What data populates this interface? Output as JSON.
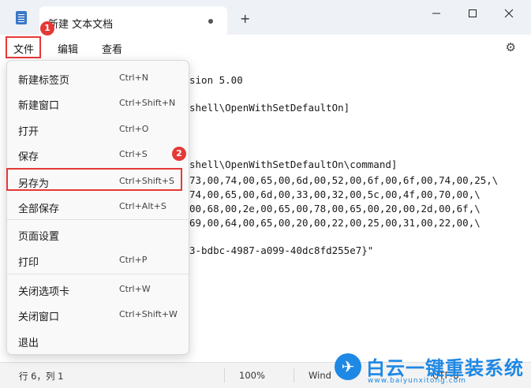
{
  "window": {
    "tab_title": "新建 文本文档",
    "new_tab_icon": "+",
    "minimize_icon": "minimize-icon",
    "maximize_icon": "maximize-icon",
    "close_icon": "close-icon"
  },
  "menubar": {
    "items": [
      "文件",
      "编辑",
      "查看"
    ],
    "settings_icon": "gear-icon"
  },
  "editor": {
    "lines": [
      "sion 5.00",
      "shell\\OpenWithSetDefaultOn]",
      "shell\\OpenWithSetDefaultOn\\command]",
      "73,00,74,00,65,00,6d,00,52,00,6f,00,6f,00,74,00,25,\\",
      "74,00,65,00,6d,00,33,00,32,00,5c,00,4f,00,70,00,\\",
      "00,68,00,2e,00,65,00,78,00,65,00,20,00,2d,00,6f,\\",
      "69,00,64,00,65,00,20,00,22,00,25,00,31,00,22,00,\\",
      "3-bdbc-4987-a099-40dc8fd255e7}\""
    ]
  },
  "file_menu": {
    "items": [
      {
        "label": "新建标签页",
        "shortcut": "Ctrl+N"
      },
      {
        "label": "新建窗口",
        "shortcut": "Ctrl+Shift+N"
      },
      {
        "label": "打开",
        "shortcut": "Ctrl+O"
      },
      {
        "label": "保存",
        "shortcut": "Ctrl+S"
      },
      {
        "label": "另存为",
        "shortcut": "Ctrl+Shift+S"
      },
      {
        "label": "全部保存",
        "shortcut": "Ctrl+Alt+S"
      },
      {
        "label": "页面设置",
        "shortcut": ""
      },
      {
        "label": "打印",
        "shortcut": "Ctrl+P"
      },
      {
        "label": "关闭选项卡",
        "shortcut": "Ctrl+W"
      },
      {
        "label": "关闭窗口",
        "shortcut": "Ctrl+Shift+W"
      },
      {
        "label": "退出",
        "shortcut": ""
      }
    ]
  },
  "annotations": {
    "step1": "1",
    "step2": "2",
    "color": "#e53935"
  },
  "statusbar": {
    "position": "行 6，列 1",
    "zoom": "100%",
    "line_ending": "Wind",
    "encoding": "UTF-8"
  },
  "watermark": {
    "brand": "白云一键重装系统",
    "url": "www.baiyunxitong.com"
  }
}
